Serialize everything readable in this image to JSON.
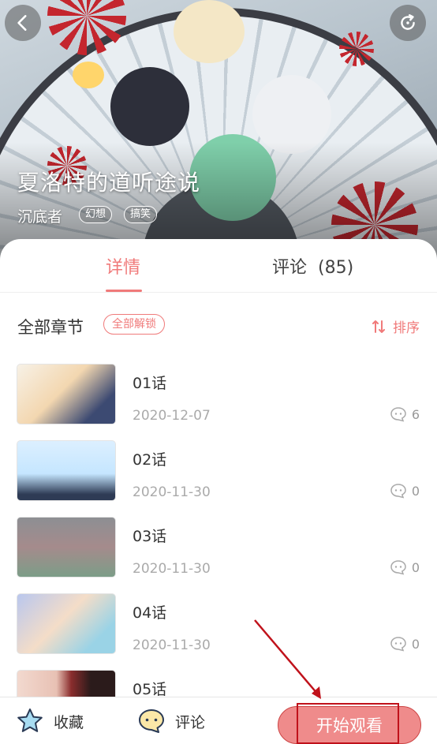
{
  "header": {
    "title": "夏洛特的道听途说",
    "author": "沉底者",
    "tags": [
      "幻想",
      "搞笑"
    ],
    "back_icon": "chevron-left-icon",
    "share_icon": "refresh-icon"
  },
  "tabs": {
    "detail_label": "详情",
    "comments_label": "评论",
    "comments_count": "(85)"
  },
  "chapters_section": {
    "title": "全部章节",
    "unlock_label": "全部解锁",
    "sort_label": "排序"
  },
  "chapters": [
    {
      "name": "01话",
      "date": "2020-12-07",
      "comments": "6"
    },
    {
      "name": "02话",
      "date": "2020-11-30",
      "comments": "0"
    },
    {
      "name": "03话",
      "date": "2020-11-30",
      "comments": "0"
    },
    {
      "name": "04话",
      "date": "2020-11-30",
      "comments": "0"
    },
    {
      "name": "05话",
      "date": "",
      "comments": ""
    }
  ],
  "bottom_bar": {
    "favorite_label": "收藏",
    "comment_label": "评论",
    "start_label": "开始观看"
  },
  "colors": {
    "accent": "#f07a7a",
    "start_button": "#ef8b8b",
    "annotation": "#c0121b"
  }
}
